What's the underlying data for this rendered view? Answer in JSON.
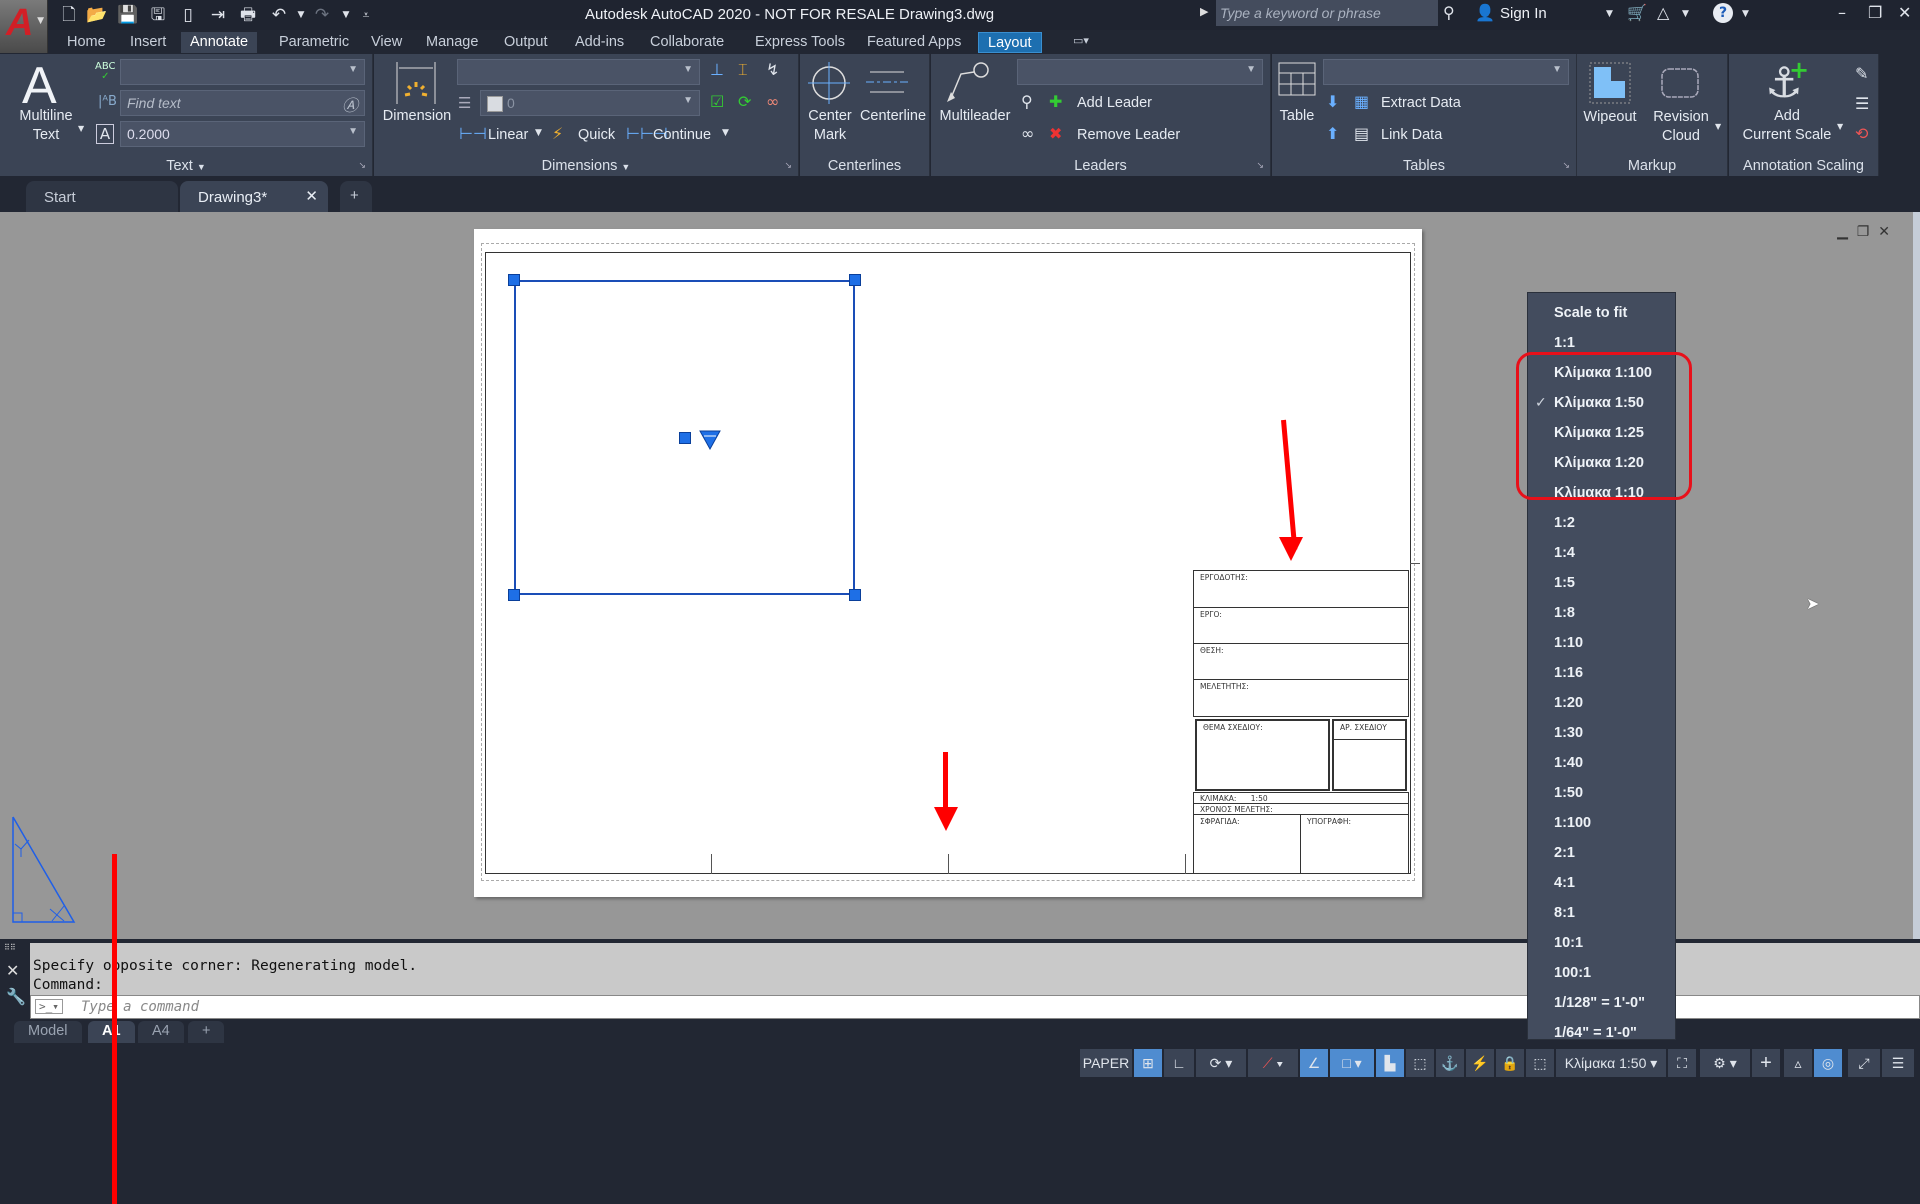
{
  "app": {
    "title": "Autodesk AutoCAD 2020 - NOT FOR RESALE    Drawing3.dwg",
    "logo_letter": "A",
    "search_placeholder": "Type a keyword or phrase",
    "sign_in": "Sign In"
  },
  "quick_access": [
    "new-icon",
    "open-icon",
    "save-icon",
    "save-as-icon",
    "open-from-web-icon",
    "save-to-web-icon",
    "plot-icon",
    "undo-icon",
    "redo-icon",
    "customize-icon"
  ],
  "ribbon_tabs": [
    {
      "label": "Home"
    },
    {
      "label": "Insert"
    },
    {
      "label": "Annotate",
      "active": true
    },
    {
      "label": "Parametric"
    },
    {
      "label": "View"
    },
    {
      "label": "Manage"
    },
    {
      "label": "Output"
    },
    {
      "label": "Add-ins"
    },
    {
      "label": "Collaborate"
    },
    {
      "label": "Express Tools"
    },
    {
      "label": "Featured Apps"
    },
    {
      "label": "Layout",
      "contextual": true
    }
  ],
  "ribbon": {
    "text": {
      "label": "Text",
      "multiline_text": "Multiline",
      "multiline_text2": "Text",
      "style_value": "",
      "find_placeholder": "Find text",
      "height_value": "0.2000"
    },
    "dimensions": {
      "label": "Dimensions",
      "dimension": "Dimension",
      "layer_value": "0",
      "linear": "Linear",
      "quick": "Quick",
      "continue": "Continue"
    },
    "centerlines": {
      "label": "Centerlines",
      "center_mark": "Center",
      "center_mark2": "Mark",
      "centerline": "Centerline"
    },
    "leaders": {
      "label": "Leaders",
      "multileader": "Multileader",
      "add_leader": "Add Leader",
      "remove_leader": "Remove Leader"
    },
    "tables": {
      "label": "Tables",
      "table": "Table",
      "extract_data": "Extract Data",
      "link_data": "Link Data"
    },
    "markup": {
      "label": "Markup",
      "wipeout": "Wipeout",
      "revision_cloud": "Revision",
      "revision_cloud2": "Cloud"
    },
    "annotation_scaling": {
      "label": "Annotation Scaling",
      "add_current_scale": "Add",
      "add_current_scale2": "Current Scale"
    }
  },
  "doc_tabs": [
    {
      "label": "Start"
    },
    {
      "label": "Drawing3*",
      "active": true
    }
  ],
  "title_block": {
    "client": "ΕΡΓΟΔΟΤΗΣ:",
    "project": "ΕΡΓΟ:",
    "location": "ΘΕΣΗ:",
    "designer": "ΜΕΛΕΤΗΤΗΣ:",
    "drawing_subject": "ΘΕΜΑ ΣΧΕΔΙΟΥ:",
    "drawing_number": "ΑΡ. ΣΧΕΔΙΟΥ",
    "scale_label": "ΚΛΙΜΑΚΑ:",
    "scale_value": "1:50",
    "study_date": "ΧΡΟΝΟΣ ΜΕΛΕΤΗΣ:",
    "stamp": "ΣΦΡΑΓΙΔΑ:",
    "signature": "ΥΠΟΓΡΑΦΗ:"
  },
  "scale_menu": {
    "items": [
      {
        "label": "Scale to fit"
      },
      {
        "label": "1:1"
      },
      {
        "label": "Κλίμακα 1:100"
      },
      {
        "label": "Κλίμακα 1:50",
        "checked": true
      },
      {
        "label": "Κλίμακα 1:25"
      },
      {
        "label": "Κλίμακα 1:20"
      },
      {
        "label": "Κλίμακα 1:10"
      },
      {
        "label": "1:2"
      },
      {
        "label": "1:4"
      },
      {
        "label": "1:5"
      },
      {
        "label": "1:8"
      },
      {
        "label": "1:10"
      },
      {
        "label": "1:16"
      },
      {
        "label": "1:20"
      },
      {
        "label": "1:30"
      },
      {
        "label": "1:40"
      },
      {
        "label": "1:50"
      },
      {
        "label": "1:100"
      },
      {
        "label": "2:1"
      },
      {
        "label": "4:1"
      },
      {
        "label": "8:1"
      },
      {
        "label": "10:1"
      },
      {
        "label": "100:1"
      },
      {
        "label": "1/128\" = 1'-0\""
      },
      {
        "label": "1/64\" = 1'-0\""
      }
    ],
    "check_mark": "✓"
  },
  "command": {
    "history_line1": "Specify opposite corner: Regenerating model.",
    "history_line2": "Command:",
    "placeholder": "Type a command"
  },
  "layout_tabs": [
    {
      "label": "Model"
    },
    {
      "label": "A1",
      "active": true
    },
    {
      "label": "A4"
    },
    {
      "label": "+"
    }
  ],
  "status_bar": {
    "space": "PAPER",
    "annotation_scale": "Κλίμακα 1:50"
  },
  "colors": {
    "accent": "#1d6fb0",
    "highlight": "#e8101a",
    "viewport": "#1a4db7"
  }
}
